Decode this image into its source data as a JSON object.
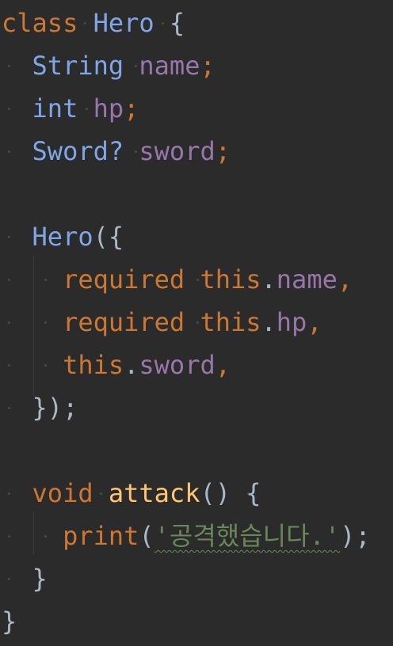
{
  "code": {
    "line1": {
      "kw": "class",
      "name": "Hero",
      "brace": "{"
    },
    "line2": {
      "type": "String",
      "field": "name",
      "semi": ";"
    },
    "line3": {
      "type": "int",
      "field": "hp",
      "semi": ";"
    },
    "line4": {
      "type": "Sword?",
      "field": "sword",
      "semi": ";"
    },
    "line6": {
      "ctor": "Hero",
      "open": "({"
    },
    "line7": {
      "kw": "required",
      "this": "this",
      "dot": ".",
      "field": "name",
      "comma": ","
    },
    "line8": {
      "kw": "required",
      "this": "this",
      "dot": ".",
      "field": "hp",
      "comma": ","
    },
    "line9": {
      "this": "this",
      "dot": ".",
      "field": "sword",
      "comma": ","
    },
    "line10": {
      "close": "});"
    },
    "line12": {
      "kw": "void",
      "fn": "attack",
      "parens": "()",
      "brace": "{"
    },
    "line13": {
      "fn": "print",
      "open": "(",
      "str": "'공격했습니다.'",
      "close": ");"
    },
    "line14": {
      "close": "}"
    },
    "line15": {
      "close": "}"
    }
  },
  "colors": {
    "background": "#2b2b2b",
    "keyword": "#cc7832",
    "type": "#7fa7e8",
    "field": "#9876aa",
    "function": "#ffc66d",
    "string": "#6a8759",
    "default": "#a9b7c6"
  }
}
